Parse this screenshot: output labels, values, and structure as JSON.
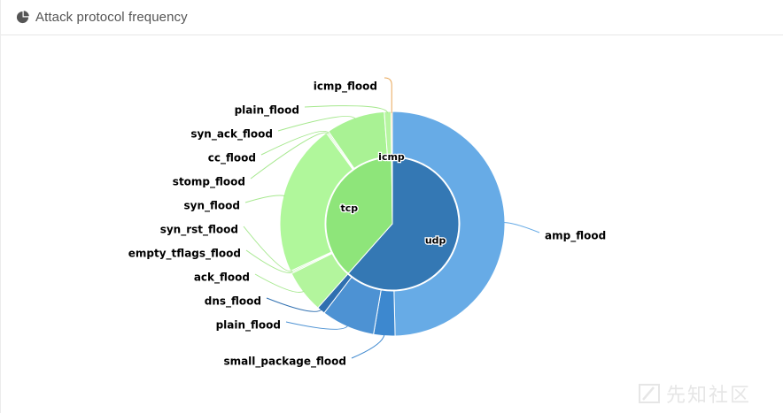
{
  "panel": {
    "title": "Attack protocol frequency",
    "icon": "pie-chart-icon"
  },
  "watermark": {
    "text": "先知社区",
    "icon": "logo-icon"
  },
  "chart_data": {
    "type": "pie",
    "subtype": "sunburst",
    "title": "Attack protocol frequency",
    "inner": [
      {
        "label": "udp",
        "value": 160,
        "color": "#3478b4"
      },
      {
        "label": "tcp",
        "value": 99.5,
        "color": "#8ee57a"
      },
      {
        "label": "icmp",
        "value": 0.5,
        "color": "#aad07a"
      }
    ],
    "outer": [
      {
        "label": "amp_flood",
        "parent": "udp",
        "value": 129,
        "color": "#67abe6",
        "line": "#67abe6"
      },
      {
        "label": "small_package_flood",
        "parent": "udp",
        "value": 8,
        "color": "#3d88cf",
        "line": "#3d88cf"
      },
      {
        "label": "plain_flood",
        "parent": "udp",
        "value": 20,
        "color": "#4d92d3",
        "line": "#4d92d3"
      },
      {
        "label": "dns_flood",
        "parent": "udp",
        "value": 3,
        "color": "#2f6fb0",
        "line": "#2f6fb0"
      },
      {
        "label": "ack_flood",
        "parent": "tcp",
        "value": 16,
        "color": "#b3f59d",
        "line": "#a6e88e"
      },
      {
        "label": "empty_tflags_flood",
        "parent": "tcp",
        "value": 0.5,
        "color": "#b3f59d",
        "line": "#a6e88e"
      },
      {
        "label": "syn_rst_flood",
        "parent": "tcp",
        "value": 0.5,
        "color": "#b3f59d",
        "line": "#a6e88e"
      },
      {
        "label": "syn_flood",
        "parent": "tcp",
        "value": 57,
        "color": "#b0f79b",
        "line": "#a6e88e"
      },
      {
        "label": "stomp_flood",
        "parent": "tcp",
        "value": 0.5,
        "color": "#b3f59d",
        "line": "#a6e88e"
      },
      {
        "label": "cc_flood",
        "parent": "tcp",
        "value": 0.5,
        "color": "#b3f59d",
        "line": "#a6e88e"
      },
      {
        "label": "syn_ack_flood",
        "parent": "tcp",
        "value": 22,
        "color": "#a9f294",
        "line": "#a6e88e"
      },
      {
        "label": "plain_flood",
        "parent": "tcp",
        "value": 2.5,
        "color": "#b6f5a0",
        "line": "#a6e88e"
      },
      {
        "label": "icmp_flood",
        "parent": "icmp",
        "value": 0.5,
        "color": "#f2c26b",
        "line": "#e8a85a"
      }
    ]
  }
}
